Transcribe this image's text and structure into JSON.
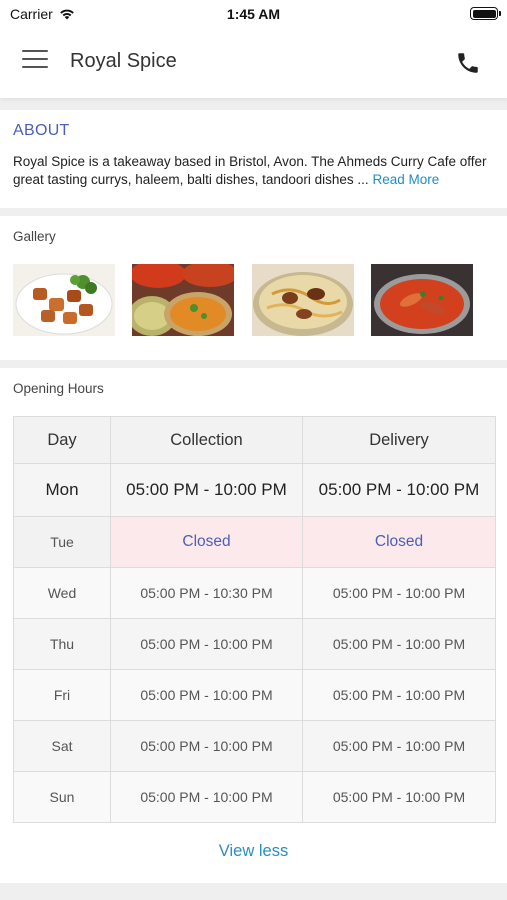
{
  "status_bar": {
    "carrier": "Carrier",
    "time": "1:45 AM"
  },
  "header": {
    "title": "Royal Spice",
    "menu_icon": "hamburger-menu-icon",
    "call_icon": "phone-icon"
  },
  "about": {
    "title": "ABOUT",
    "text": "Royal Spice is a takeaway based in Bristol, Avon. The Ahmeds Curry Cafe offer great tasting currys, haleem, balti dishes, tandoori dishes ...",
    "read_more": "Read More"
  },
  "gallery": {
    "title": "Gallery"
  },
  "opening_hours": {
    "title": "Opening Hours",
    "columns": [
      "Day",
      "Collection",
      "Delivery"
    ],
    "rows": [
      {
        "day": "Mon",
        "collection": "05:00 PM - 10:00 PM",
        "delivery": "05:00 PM - 10:00 PM"
      },
      {
        "day": "Tue",
        "collection": "Closed",
        "delivery": "Closed"
      },
      {
        "day": "Wed",
        "collection": "05:00 PM - 10:30 PM",
        "delivery": "05:00 PM - 10:00 PM"
      },
      {
        "day": "Thu",
        "collection": "05:00 PM - 10:00 PM",
        "delivery": "05:00 PM - 10:00 PM"
      },
      {
        "day": "Fri",
        "collection": "05:00 PM - 10:00 PM",
        "delivery": "05:00 PM - 10:00 PM"
      },
      {
        "day": "Sat",
        "collection": "05:00 PM - 10:00 PM",
        "delivery": "05:00 PM - 10:00 PM"
      },
      {
        "day": "Sun",
        "collection": "05:00 PM - 10:00 PM",
        "delivery": "05:00 PM - 10:00 PM"
      }
    ],
    "view_less": "View less"
  },
  "colors": {
    "accent": "#4a5fb5",
    "link": "#1f8fc7",
    "closed_bg": "#fce9ec"
  }
}
